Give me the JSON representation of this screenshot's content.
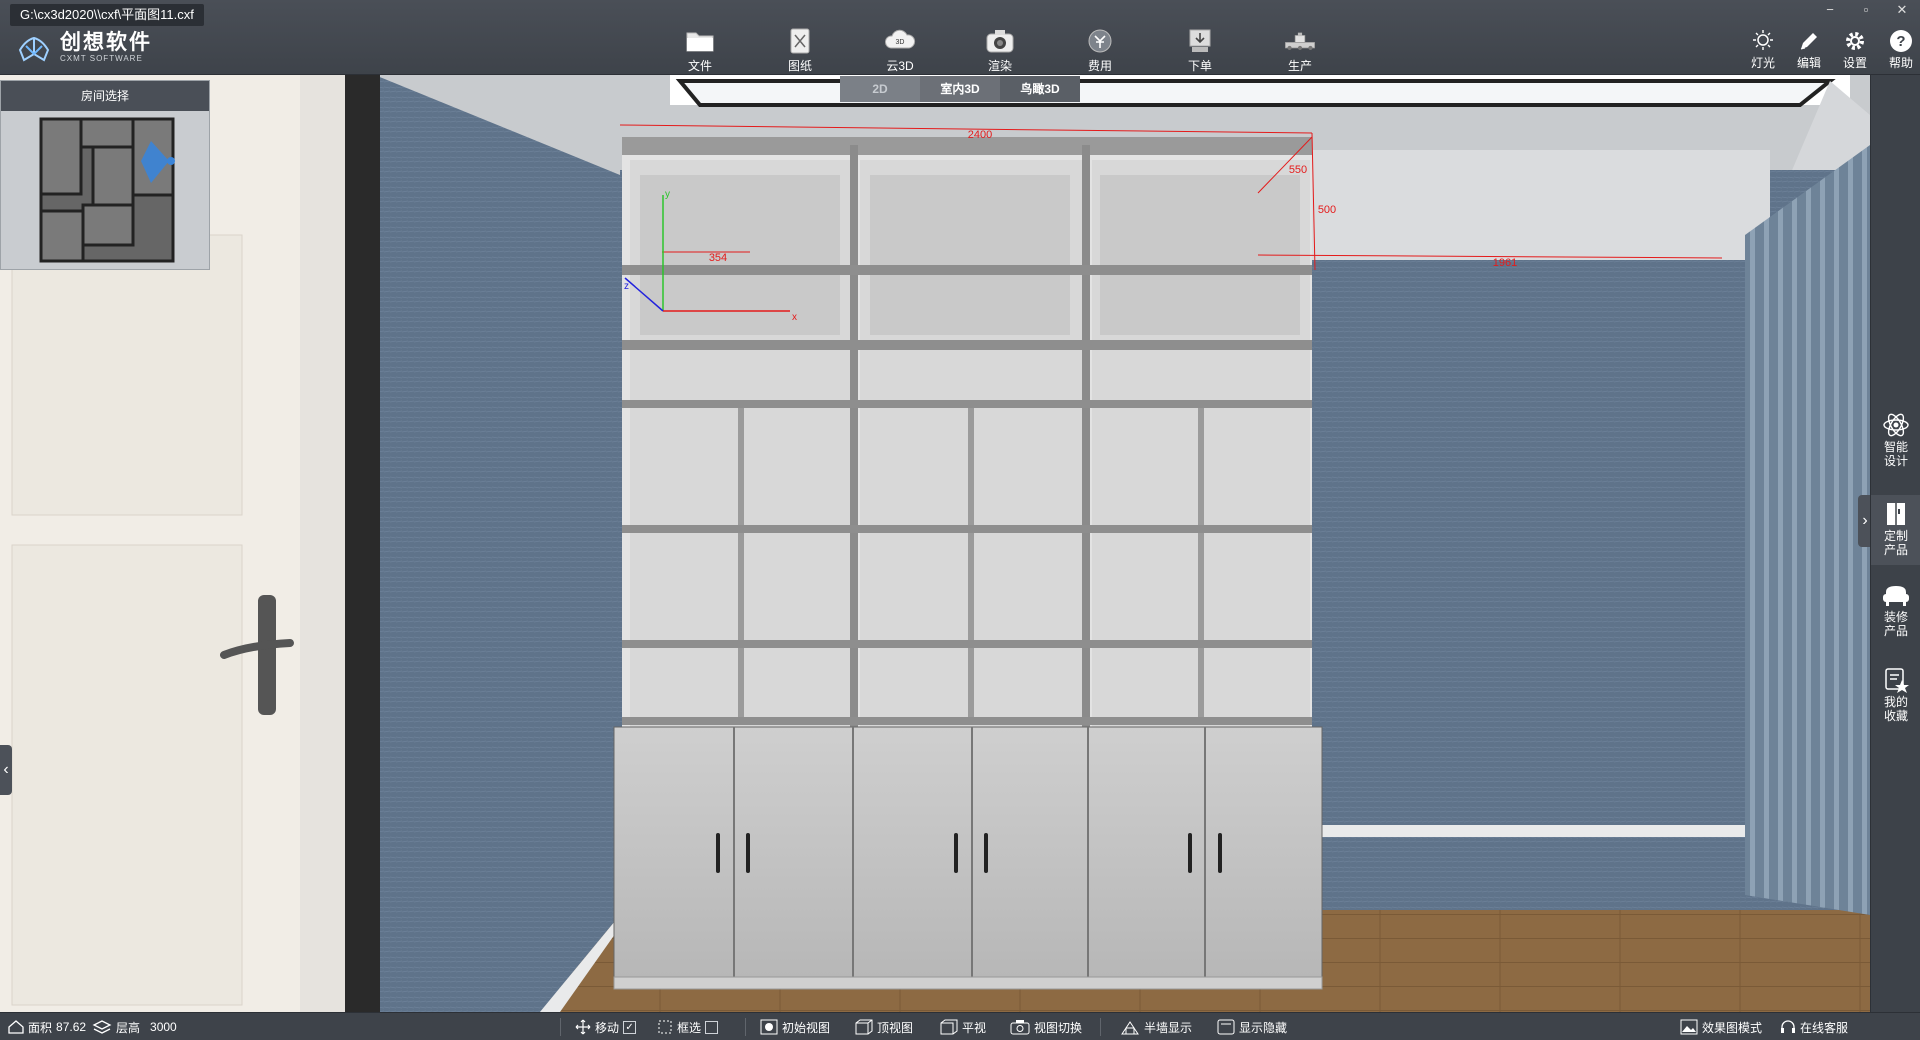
{
  "window": {
    "title": "G:\\cx3d2020\\\\cxf\\平面图11.cxf",
    "controls": [
      "−",
      "▫",
      "✕"
    ]
  },
  "brand": {
    "name_cn": "创想软件",
    "name_en": "CXMT SOFTWARE",
    "logo_text": "CXMT"
  },
  "toolbar": {
    "items": [
      {
        "label": "文件",
        "icon": "folder-icon"
      },
      {
        "label": "图纸",
        "icon": "drawing-icon"
      },
      {
        "label": "云3D",
        "icon": "cloud-3d-icon",
        "badge": "3D"
      },
      {
        "label": "渲染",
        "icon": "camera-icon"
      },
      {
        "label": "费用",
        "icon": "cost-icon"
      },
      {
        "label": "下单",
        "icon": "order-icon"
      },
      {
        "label": "生产",
        "icon": "factory-icon"
      }
    ]
  },
  "right_tools": {
    "items": [
      {
        "label": "灯光",
        "icon": "light-icon"
      },
      {
        "label": "编辑",
        "icon": "edit-icon"
      },
      {
        "label": "设置",
        "icon": "gear-icon"
      },
      {
        "label": "帮助",
        "icon": "help-icon"
      }
    ]
  },
  "view_tabs": [
    {
      "label": "2D",
      "state": "inactive"
    },
    {
      "label": "室内3D",
      "state": "normal"
    },
    {
      "label": "鸟瞰3D",
      "state": "active"
    }
  ],
  "room_panel": {
    "title": "房间选择"
  },
  "dimensions": {
    "width": "2400",
    "depth": "550",
    "height": "500",
    "inner": "354",
    "right_gap": "1961"
  },
  "axes": {
    "x": "x",
    "y": "y",
    "z": "z"
  },
  "right_panel": {
    "items": [
      {
        "label": "智能设计",
        "icon": "atom-icon"
      },
      {
        "label": "定制产品",
        "icon": "cabinet-icon"
      },
      {
        "label": "装修产品",
        "icon": "sofa-icon"
      },
      {
        "label": "我的收藏",
        "icon": "favorite-icon"
      }
    ],
    "expand_glyph": "›",
    "collapse_glyph": "‹"
  },
  "statusbar": {
    "area_label": "面积",
    "area_value": "87.62",
    "height_label": "层高",
    "height_value": "3000",
    "move_label": "移动",
    "move_checked": "✓",
    "boxselect_label": "框选",
    "boxselect_checked": "",
    "initial_view": "初始视图",
    "top_view": "顶视图",
    "flat_view": "平视",
    "view_switch": "视图切换",
    "half_wall": "半墙显示",
    "show_hide": "显示隐藏",
    "render_mode": "效果图模式",
    "online_service": "在线客服"
  },
  "colors": {
    "topbar": "#43484f",
    "wall": "#5a6e86",
    "floor": "#8a6a45",
    "cabinet": "#bdbdbd",
    "dimension": "#e41b1b"
  }
}
